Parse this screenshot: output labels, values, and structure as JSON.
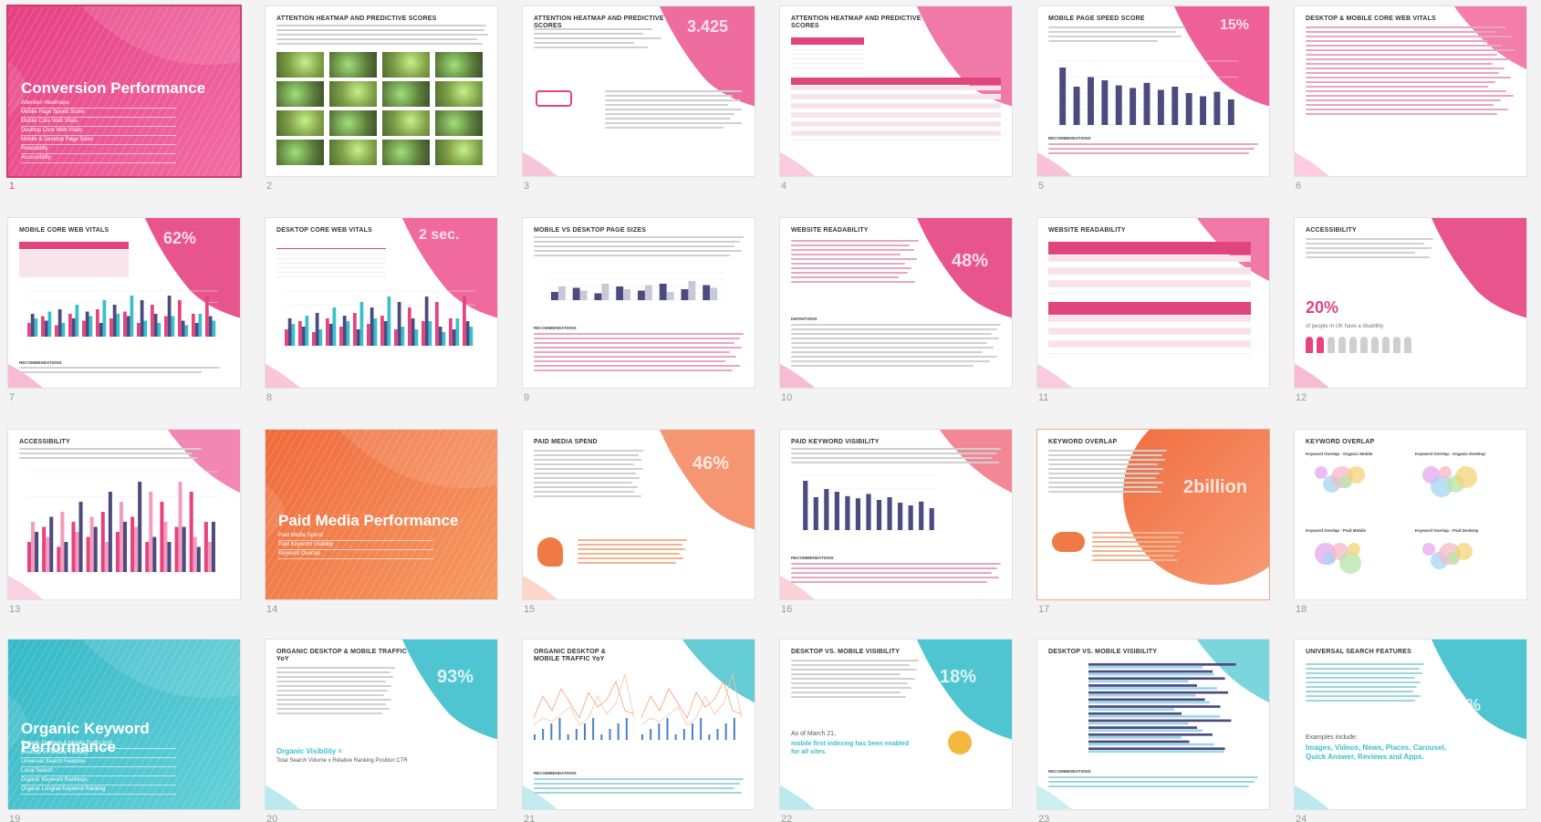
{
  "slides": [
    {
      "n": "1",
      "title": "Conversion Performance",
      "toc": [
        "Attention Heatmaps",
        "Mobile Page Speed Score",
        "Mobile Core Web Vitals",
        "Desktop Core Web Vitals",
        "Mobile & Desktop Page Sizes",
        "Readability",
        "Accessibility"
      ],
      "selected": true
    },
    {
      "n": "2",
      "title": "ATTENTION HEATMAP AND PREDICTIVE SCORES"
    },
    {
      "n": "3",
      "title": "ATTENTION HEATMAP AND PREDICTIVE SCORES",
      "stat": "3.425"
    },
    {
      "n": "4",
      "title": "ATTENTION HEATMAP AND PREDICTIVE SCORES"
    },
    {
      "n": "5",
      "title": "MOBILE PAGE SPEED SCORE",
      "stat": "15%",
      "sub": "RECOMMENDATIONS"
    },
    {
      "n": "6",
      "title": "DESKTOP & MOBILE CORE WEB VITALS"
    },
    {
      "n": "7",
      "title": "MOBILE CORE WEB VITALS",
      "stat": "62%",
      "sub": "RECOMMENDATIONS"
    },
    {
      "n": "8",
      "title": "DESKTOP CORE WEB VITALS",
      "stat": "2 sec."
    },
    {
      "n": "9",
      "title": "MOBILE VS DESKTOP PAGE SIZES",
      "sub": "RECOMMENDATIONS"
    },
    {
      "n": "10",
      "title": "WEBSITE READABILITY",
      "stat": "48%",
      "sub": "DEFINITIONS"
    },
    {
      "n": "11",
      "title": "WEBSITE READABILITY"
    },
    {
      "n": "12",
      "title": "ACCESSIBILITY",
      "stat": "20%",
      "caption": "of people in UK have a disability"
    },
    {
      "n": "13",
      "title": "ACCESSIBILITY"
    },
    {
      "n": "14",
      "title": "Paid Media Performance",
      "toc": [
        "Paid Media Spend",
        "Paid Keyword Visibility",
        "Keyword Overlap"
      ]
    },
    {
      "n": "15",
      "title": "PAID MEDIA SPEND",
      "stat": "46%"
    },
    {
      "n": "16",
      "title": "PAID KEYWORD VISIBILITY",
      "sub": "RECOMMENDATIONS"
    },
    {
      "n": "17",
      "title": "KEYWORD OVERLAP",
      "stat": "2billion"
    },
    {
      "n": "18",
      "title": "KEYWORD OVERLAP",
      "sub1": "Keyword Overlap - Organic Mobile",
      "sub2": "Keyword Overlap - Organic Desktop",
      "sub3": "Keyword Overlap - Paid Mobile",
      "sub4": "Keyword Overlap - Paid Desktop"
    },
    {
      "n": "19",
      "title": "Organic Keyword Performance",
      "toc": [
        "Organic Desktop & Mobile Traffic YoY",
        "Desktop Vs Mobile Visibility",
        "Universal Search Features",
        "Local Search",
        "Organic Keyword Rankings",
        "Organic Longtail Keyword Ranking"
      ]
    },
    {
      "n": "20",
      "title": "ORGANIC DESKTOP & MOBILE TRAFFIC YoY",
      "stat": "93%",
      "visibility": "Organic Visibility =",
      "formula": "Total Search Volume x Relative Ranking Position CTR"
    },
    {
      "n": "21",
      "title": "ORGANIC DESKTOP & MOBILE TRAFFIC YoY",
      "sub": "RECOMMENDATIONS"
    },
    {
      "n": "22",
      "title": "DESKTOP VS. MOBILE VISIBILITY",
      "stat": "18%",
      "asof": "As of March 21,",
      "indexing": "mobile first indexing has been enabled for all sites."
    },
    {
      "n": "23",
      "title": "DESKTOP VS. MOBILE VISIBILITY",
      "sub": "RECOMMENDATIONS"
    },
    {
      "n": "24",
      "title": "UNIVERSAL SEARCH FEATURES",
      "stat": "50%",
      "examples": "Examples include:",
      "features": "Images, Videos, News, Places, Carousel, Quick Answer, Reviews and Apps."
    }
  ],
  "colors": {
    "pink": "#e6437f",
    "orange": "#f07a45",
    "teal": "#3cbfcc",
    "navy": "#4b4b80"
  }
}
